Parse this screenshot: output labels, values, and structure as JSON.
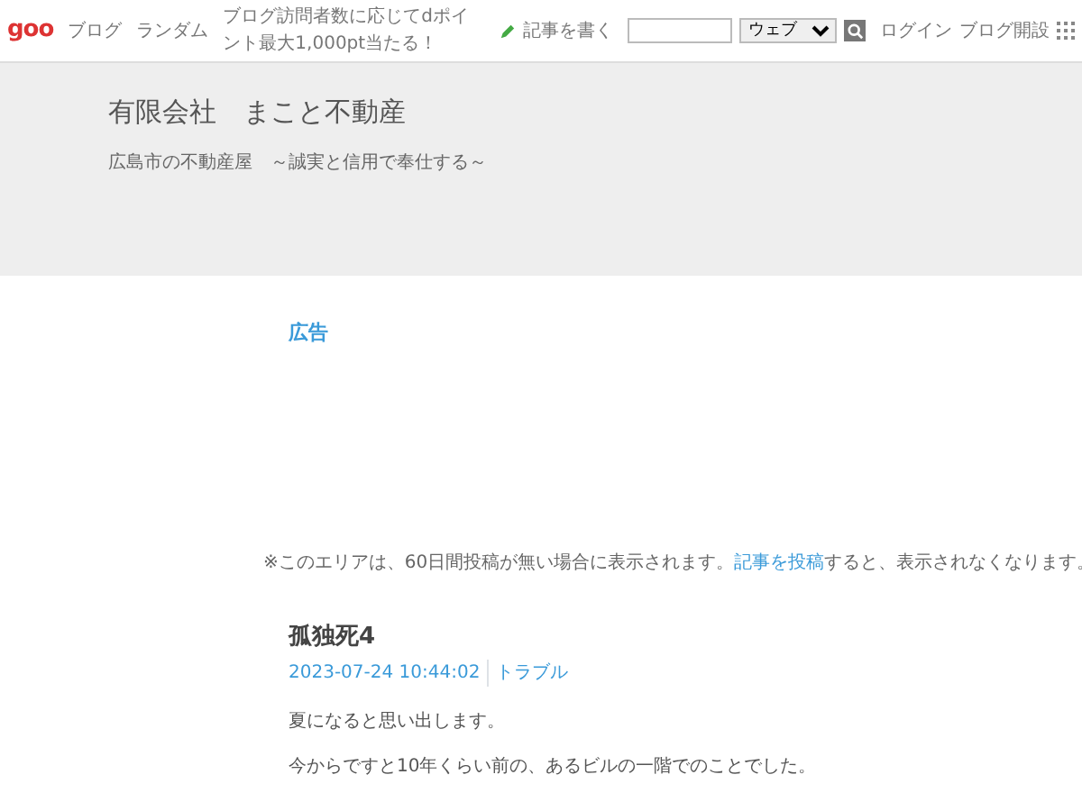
{
  "topbar": {
    "logo": "goo",
    "links": [
      "ブログ",
      "ランダム"
    ],
    "promo": "ブログ訪問者数に応じてdポイント最大1,000pt当たる！",
    "write_link": "記事を書く",
    "search_scope": "ウェブ",
    "account_links": [
      "ログイン",
      "ブログ開設"
    ]
  },
  "header": {
    "title": "有限会社　まこと不動産",
    "description": "広島市の不動産屋　～誠実と信用で奉仕する～"
  },
  "ad_section": {
    "heading": "広告",
    "notice_before": "※このエリアは、60日間投稿が無い場合に表示されます。",
    "notice_link": "記事を投稿",
    "notice_after": "すると、表示されなくなります。"
  },
  "post": {
    "title": "孤独死4",
    "date": "2023-07-24 10:44:02",
    "category": "トラブル",
    "paragraphs": [
      "夏になると思い出します。",
      "今からですと10年くらい前の、あるビルの一階でのことでした。"
    ]
  }
}
